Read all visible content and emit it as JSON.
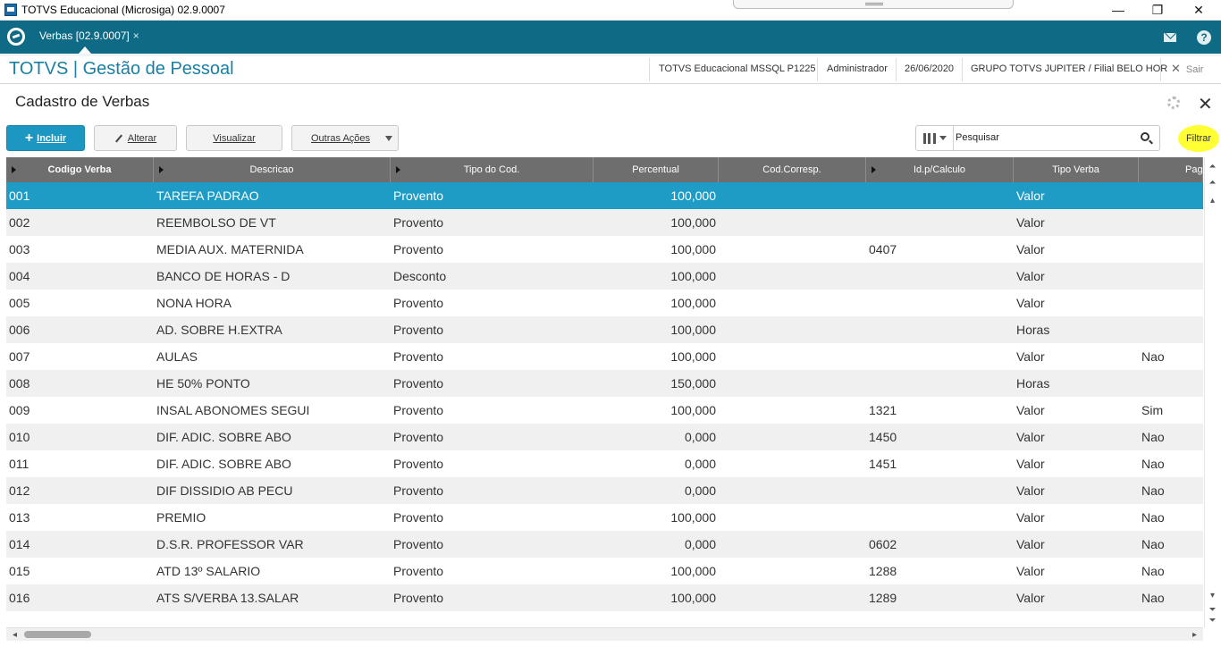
{
  "window": {
    "title": "TOTVS Educacional (Microsiga) 02.9.0007",
    "minimize": "—",
    "restore": "❐",
    "close": "✕"
  },
  "tabbar": {
    "tab_label": "Verbas [02.9.0007]",
    "tab_close": "×",
    "mail_icon": "mail-icon",
    "help_label": "?"
  },
  "module": {
    "title": "TOTVS | Gestão de Pessoal",
    "environment": "TOTVS Educacional MSSQL P1225",
    "user": "Administrador",
    "date": "26/06/2020",
    "company": "GRUPO TOTVS JUPITER / Filial BELO HOR",
    "exit_label": "Sair",
    "exit_x": "✕"
  },
  "page": {
    "title": "Cadastro de Verbas",
    "close": "✕"
  },
  "toolbar": {
    "incluir": "Incluir",
    "alterar": "Alterar",
    "visualizar": "Visualizar",
    "outras_acoes": "Outras Ações",
    "search_placeholder": "Pesquisar",
    "filtrar": "Filtrar"
  },
  "grid": {
    "columns": [
      "Codigo Verba",
      "Descricao",
      "Tipo do Cod.",
      "Percentual",
      "Cod.Corresp.",
      "Id.p/Calculo",
      "Tipo Verba",
      "Pag"
    ],
    "rows": [
      {
        "code": "001",
        "desc": "TAREFA PADRAO",
        "tipo": "Provento",
        "perc": "100,000",
        "corresp": "",
        "calc": "",
        "verba": "Valor",
        "pag": ""
      },
      {
        "code": "002",
        "desc": "REEMBOLSO DE VT",
        "tipo": "Provento",
        "perc": "100,000",
        "corresp": "",
        "calc": "",
        "verba": "Valor",
        "pag": ""
      },
      {
        "code": "003",
        "desc": "MEDIA AUX. MATERNIDA",
        "tipo": "Provento",
        "perc": "100,000",
        "corresp": "",
        "calc": "0407",
        "verba": "Valor",
        "pag": ""
      },
      {
        "code": "004",
        "desc": "BANCO DE HORAS - D",
        "tipo": "Desconto",
        "perc": "100,000",
        "corresp": "",
        "calc": "",
        "verba": "Valor",
        "pag": ""
      },
      {
        "code": "005",
        "desc": "NONA HORA",
        "tipo": "Provento",
        "perc": "100,000",
        "corresp": "",
        "calc": "",
        "verba": "Valor",
        "pag": ""
      },
      {
        "code": "006",
        "desc": "AD. SOBRE H.EXTRA",
        "tipo": "Provento",
        "perc": "100,000",
        "corresp": "",
        "calc": "",
        "verba": "Horas",
        "pag": ""
      },
      {
        "code": "007",
        "desc": "AULAS",
        "tipo": "Provento",
        "perc": "100,000",
        "corresp": "",
        "calc": "",
        "verba": "Valor",
        "pag": "Nao"
      },
      {
        "code": "008",
        "desc": "HE 50% PONTO",
        "tipo": "Provento",
        "perc": "150,000",
        "corresp": "",
        "calc": "",
        "verba": "Horas",
        "pag": ""
      },
      {
        "code": "009",
        "desc": "INSAL ABONOMES SEGUI",
        "tipo": "Provento",
        "perc": "100,000",
        "corresp": "",
        "calc": "1321",
        "verba": "Valor",
        "pag": "Sim"
      },
      {
        "code": "010",
        "desc": "DIF. ADIC. SOBRE ABO",
        "tipo": "Provento",
        "perc": "0,000",
        "corresp": "",
        "calc": "1450",
        "verba": "Valor",
        "pag": "Nao"
      },
      {
        "code": "011",
        "desc": "DIF. ADIC. SOBRE ABO",
        "tipo": "Provento",
        "perc": "0,000",
        "corresp": "",
        "calc": "1451",
        "verba": "Valor",
        "pag": "Nao"
      },
      {
        "code": "012",
        "desc": "DIF DISSIDIO AB PECU",
        "tipo": "Provento",
        "perc": "0,000",
        "corresp": "",
        "calc": "",
        "verba": "Valor",
        "pag": "Nao"
      },
      {
        "code": "013",
        "desc": "PREMIO",
        "tipo": "Provento",
        "perc": "100,000",
        "corresp": "",
        "calc": "",
        "verba": "Valor",
        "pag": "Nao"
      },
      {
        "code": "014",
        "desc": "D.S.R. PROFESSOR VAR",
        "tipo": "Provento",
        "perc": "0,000",
        "corresp": "",
        "calc": "0602",
        "verba": "Valor",
        "pag": "Nao"
      },
      {
        "code": "015",
        "desc": "ATD 13º SALARIO",
        "tipo": "Provento",
        "perc": "100,000",
        "corresp": "",
        "calc": "1288",
        "verba": "Valor",
        "pag": "Nao"
      },
      {
        "code": "016",
        "desc": "ATS S/VERBA 13.SALAR",
        "tipo": "Provento",
        "perc": "100,000",
        "corresp": "",
        "calc": "1289",
        "verba": "Valor",
        "pag": "Nao"
      }
    ],
    "selected_index": 0
  },
  "colors": {
    "brand": "#0f6b85",
    "accent": "#1c97c2",
    "selected_row": "#1e9cc6",
    "header_gray": "#6e6e6e",
    "highlight": "#ffff33"
  }
}
